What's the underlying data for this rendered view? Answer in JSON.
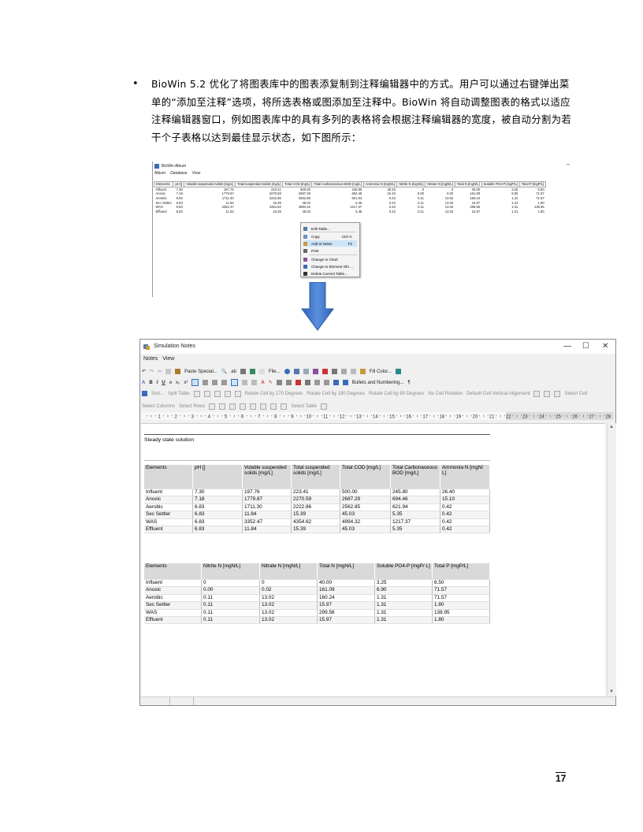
{
  "bullet": {
    "dot": "•",
    "text": "BioWin 5.2 优化了将图表库中的图表添复制到注释编辑器中的方式。用户可以通过右键弹出菜单的“添加至注释”选项，将所选表格或图添加至注释中。BioWin 将自动调整图表的格式以适应注释编辑器窗口，例如图表库中的具有多列的表格将会根据注释编辑器的宽度，被自动分割为若干个子表格以达到最佳显示状态，如下图所示："
  },
  "album": {
    "title": "BioWin Album",
    "menu": [
      "Album",
      "Database",
      "View"
    ],
    "minimize": "–",
    "headers": [
      "Elements",
      "pH []",
      "Volatile suspended solids [mg/L]",
      "Total suspended solids [mg/L]",
      "Total COD [mg/L]",
      "Total Carbonaceous BOD [mg/L]",
      "Ammonia N [mgN/L]",
      "Nitrite N [mgN/L]",
      "Nitrate N [mgN/L]",
      "Total N [mgN/L]",
      "Soluble PO4-P [mgP/L]",
      "Total P [mgP/L]"
    ],
    "rows": [
      [
        "Influent",
        "7.30",
        "197.76",
        "223.41",
        "500.00",
        "245.80",
        "26.40",
        "0",
        "0",
        "40.00",
        "3.25",
        "6.50"
      ],
      [
        "Anoxic",
        "7.18",
        "1779.87",
        "2270.59",
        "2687.29",
        "694.46",
        "15.10",
        "0.00",
        "0.02",
        "161.09",
        "6.90",
        "71.57"
      ],
      [
        "Aerobic",
        "6.83",
        "1711.30",
        "2222.86",
        "2562.85",
        "621.94",
        "0.42",
        "0.11",
        "13.02",
        "160.24",
        "1.31",
        "71.57"
      ],
      [
        "Sec Settler",
        "6.83",
        "11.84",
        "15.39",
        "45.03",
        "5.35",
        "0.42",
        "0.11",
        "13.02",
        "15.97",
        "1.31",
        "1.80"
      ],
      [
        "WAS",
        "6.83",
        "3352.47",
        "4354.62",
        "4994.32",
        "1217.37",
        "0.42",
        "0.11",
        "13.02",
        "299.56",
        "1.31",
        "138.95"
      ],
      [
        "Effluent",
        "6.83",
        "11.84",
        "15.39",
        "45.03",
        "5.35",
        "0.42",
        "0.11",
        "13.02",
        "15.97",
        "1.31",
        "1.80"
      ]
    ],
    "context_menu": [
      {
        "label": "Edit Table...",
        "shortcut": "",
        "icon": "edit-table-icon",
        "color": "#5577aa"
      },
      {
        "label": "Copy",
        "shortcut": "Ctrl+C",
        "icon": "copy-icon",
        "color": "#6a8cc7"
      },
      {
        "label": "Add to Notes",
        "shortcut": "F2",
        "icon": "notes-icon",
        "color": "#c69a3a"
      },
      {
        "label": "Print",
        "shortcut": "",
        "icon": "printer-icon",
        "color": "#666666"
      },
      {
        "label": "Change to Chart",
        "shortcut": "",
        "icon": "chart-icon",
        "color": "#8a4fa0"
      },
      {
        "label": "Change to Element info ...",
        "shortcut": "",
        "icon": "info-icon",
        "color": "#3a6bb8"
      },
      {
        "label": "Delete Current Table...",
        "shortcut": "",
        "icon": "delete-icon",
        "color": "#333333"
      }
    ]
  },
  "notes": {
    "title": "Simulation Notes",
    "window_buttons": [
      "—",
      "☐",
      "✕"
    ],
    "menu": [
      "Notes",
      "View"
    ],
    "toolbar1": {
      "paste_special": "Paste Special...",
      "file": "File...",
      "fill_color": "Fill Color..."
    },
    "toolbar2": {
      "bullets": "Bullets and Numbering...",
      "pilcrow": "¶",
      "bold": "B",
      "italic": "I",
      "underline": "U"
    },
    "toolbar3": [
      "Sort...",
      "Split Table",
      "Rotate Cell by 270 Degrees",
      "Rotate Cell by 180 Degrees",
      "Rotate Cell by 90 Degrees",
      "No Cell Rotation",
      "Default Cell Vertical Alignment",
      "Select Cell"
    ],
    "toolbar4": [
      "Select Columns",
      "Select Rows",
      "Select Table"
    ],
    "ruler": [
      "1",
      "2",
      "3",
      "4",
      "5",
      "6",
      "7",
      "8",
      "9",
      "10",
      "11",
      "12",
      "13",
      "14",
      "15",
      "16",
      "17",
      "18",
      "19",
      "20",
      "21",
      "22",
      "23",
      "24",
      "25",
      "26",
      "27",
      "28"
    ],
    "heading": "Steady state solution",
    "table1": {
      "headers": [
        "Elements",
        "pH []",
        "Volatile suspended solids [mg/L]",
        "Total suspended solids [mg/L]",
        "Total COD [mg/L]",
        "Total Carbonaceous BOD [mg/L]",
        "Ammonia N [mgN/ L]"
      ],
      "rows": [
        [
          "Influent",
          "7.30",
          "197.76",
          "223.41",
          "500.00",
          "245.80",
          "26.40"
        ],
        [
          "Anoxic",
          "7.18",
          "1779.87",
          "2270.59",
          "2687.29",
          "694.46",
          "15.10"
        ],
        [
          "Aerobic",
          "6.83",
          "1711.30",
          "2222.86",
          "2562.85",
          "621.94",
          "0.42"
        ],
        [
          "Sec Settler",
          "6.83",
          "11.84",
          "15.39",
          "45.03",
          "5.35",
          "0.42"
        ],
        [
          "WAS",
          "6.83",
          "3352.47",
          "4354.62",
          "4994.32",
          "1217.37",
          "0.42"
        ],
        [
          "Effluent",
          "6.83",
          "11.84",
          "15.39",
          "45.03",
          "5.35",
          "0.42"
        ]
      ]
    },
    "table2": {
      "headers": [
        "Elements",
        "Nitrite N [mgN/L]",
        "Nitrate N [mgN/L]",
        "Total N [mgN/L]",
        "Soluble PO4-P [mgP/ L]",
        "Total P [mgP/L]"
      ],
      "rows": [
        [
          "Influent",
          "0",
          "0",
          "40.00",
          "3.25",
          "6.50"
        ],
        [
          "Anoxic",
          "0.00",
          "0.02",
          "161.09",
          "6.90",
          "71.57"
        ],
        [
          "Aerobic",
          "0.11",
          "13.02",
          "160.24",
          "1.31",
          "71.57"
        ],
        [
          "Sec Settler",
          "0.11",
          "13.02",
          "15.97",
          "1.31",
          "1.80"
        ],
        [
          "WAS",
          "0.11",
          "13.02",
          "299.56",
          "1.31",
          "138.95"
        ],
        [
          "Effluent",
          "0.11",
          "13.02",
          "15.97",
          "1.31",
          "1.80"
        ]
      ]
    }
  },
  "page_number": "17"
}
